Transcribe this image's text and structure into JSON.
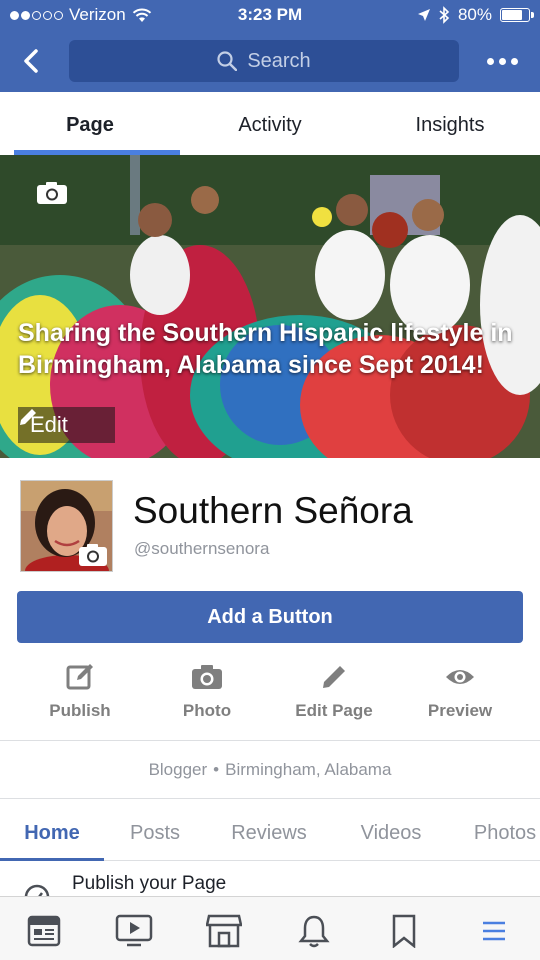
{
  "status_bar": {
    "carrier": "Verizon",
    "time": "3:23 PM",
    "battery": "80%",
    "battery_level": 0.8,
    "signal_bars": 2
  },
  "nav": {
    "search_placeholder": "Search"
  },
  "tabs": [
    {
      "label": "Page",
      "active": true
    },
    {
      "label": "Activity",
      "active": false
    },
    {
      "label": "Insights",
      "active": false
    }
  ],
  "cover": {
    "caption": "Sharing the Southern Hispanic lifestyle in Birmingham, Alabama since Sept 2014!",
    "edit_label": "Edit"
  },
  "profile": {
    "name": "Southern Señora",
    "handle": "@southernsenora"
  },
  "add_button_label": "Add a Button",
  "actions": [
    {
      "label": "Publish",
      "icon": "compose-icon"
    },
    {
      "label": "Photo",
      "icon": "camera-icon"
    },
    {
      "label": "Edit Page",
      "icon": "pencil-icon"
    },
    {
      "label": "Preview",
      "icon": "eye-icon"
    }
  ],
  "about": {
    "category": "Blogger",
    "location": "Birmingham, Alabama"
  },
  "subtabs": [
    {
      "label": "Home",
      "active": true
    },
    {
      "label": "Posts",
      "active": false
    },
    {
      "label": "Reviews",
      "active": false
    },
    {
      "label": "Videos",
      "active": false
    },
    {
      "label": "Photos",
      "active": false
    }
  ],
  "publish_row": {
    "label": "Publish your Page"
  },
  "bottom_nav": [
    {
      "icon": "news-feed-icon"
    },
    {
      "icon": "video-icon"
    },
    {
      "icon": "marketplace-icon"
    },
    {
      "icon": "notifications-icon"
    },
    {
      "icon": "bookmark-icon"
    },
    {
      "icon": "menu-icon",
      "active": true
    }
  ],
  "colors": {
    "brand": "#4267b2",
    "tab_indicator": "#4a7fe0",
    "muted": "#90949c"
  }
}
